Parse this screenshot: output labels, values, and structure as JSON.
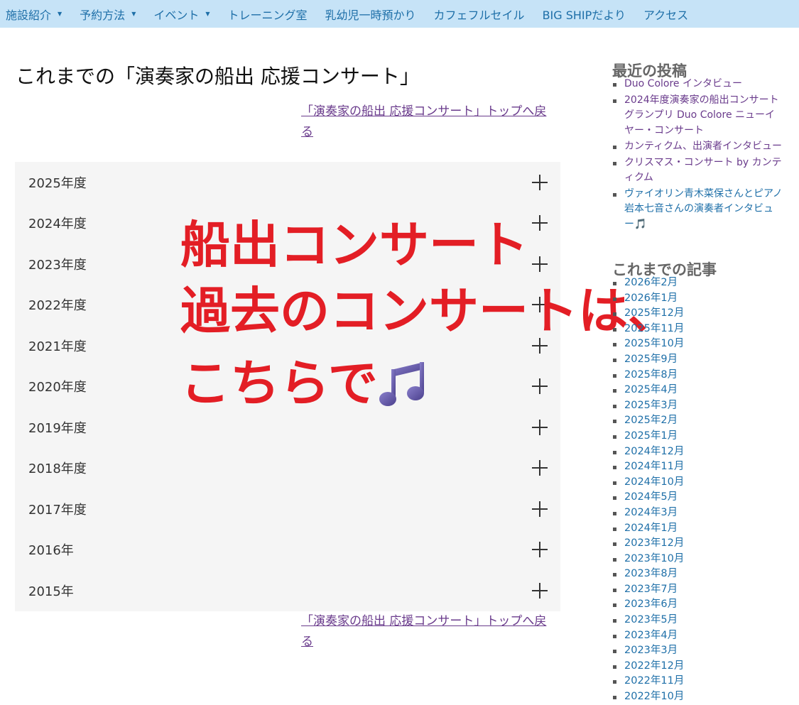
{
  "nav": {
    "items": [
      {
        "label": "施設紹介",
        "has_dropdown": true
      },
      {
        "label": "予約方法",
        "has_dropdown": true
      },
      {
        "label": "イベント",
        "has_dropdown": true
      },
      {
        "label": "トレーニング室",
        "has_dropdown": false
      },
      {
        "label": "乳幼児一時預かり",
        "has_dropdown": false
      },
      {
        "label": "カフェフルセイル",
        "has_dropdown": false
      },
      {
        "label": "BIG SHIPだより",
        "has_dropdown": false
      },
      {
        "label": "アクセス",
        "has_dropdown": false
      }
    ],
    "caret": "▼"
  },
  "main": {
    "title": "これまでの「演奏家の船出 応援コンサート」",
    "back_link": "「演奏家の船出 応援コンサート」トップへ戻る",
    "accordion": [
      "2025年度",
      "2024年度",
      "2023年度",
      "2022年度",
      "2021年度",
      "2020年度",
      "2019年度",
      "2018年度",
      "2017年度",
      "2016年",
      "2015年"
    ]
  },
  "overlay": {
    "line1": "船出コンサート",
    "line2": "過去のコンサートは、",
    "line3": "こちらで",
    "icon": "musical-note-icon",
    "color": "#e31e25"
  },
  "sidebar": {
    "recent_heading": "最近の投稿",
    "recent_posts": [
      {
        "title": "Duo Colore インタビュー",
        "visited": true
      },
      {
        "title": "2024年度演奏家の船出コンサートグランプリ Duo Colore ニューイヤー・コンサート",
        "visited": true
      },
      {
        "title": "カンティクム、出演者インタビュー",
        "visited": true
      },
      {
        "title": "クリスマス・コンサート by カンティクム",
        "visited": true
      },
      {
        "title": "ヴァイオリン青木菜保さんとピアノ岩本七音さんの演奏者インタビュー🎵",
        "visited": false
      }
    ],
    "archive_heading": "これまでの記事",
    "archives": [
      "2026年2月",
      "2026年1月",
      "2025年12月",
      "2025年11月",
      "2025年10月",
      "2025年9月",
      "2025年8月",
      "2025年4月",
      "2025年3月",
      "2025年2月",
      "2025年1月",
      "2024年12月",
      "2024年11月",
      "2024年10月",
      "2024年5月",
      "2024年3月",
      "2024年1月",
      "2023年12月",
      "2023年10月",
      "2023年8月",
      "2023年7月",
      "2023年6月",
      "2023年5月",
      "2023年4月",
      "2023年3月",
      "2022年12月",
      "2022年11月",
      "2022年10月"
    ]
  },
  "colors": {
    "nav_bg": "#c6e3f7",
    "link_blue": "#1e6fa8",
    "link_visited": "#6a3b8c",
    "accordion_bg": "#f5f5f5"
  }
}
